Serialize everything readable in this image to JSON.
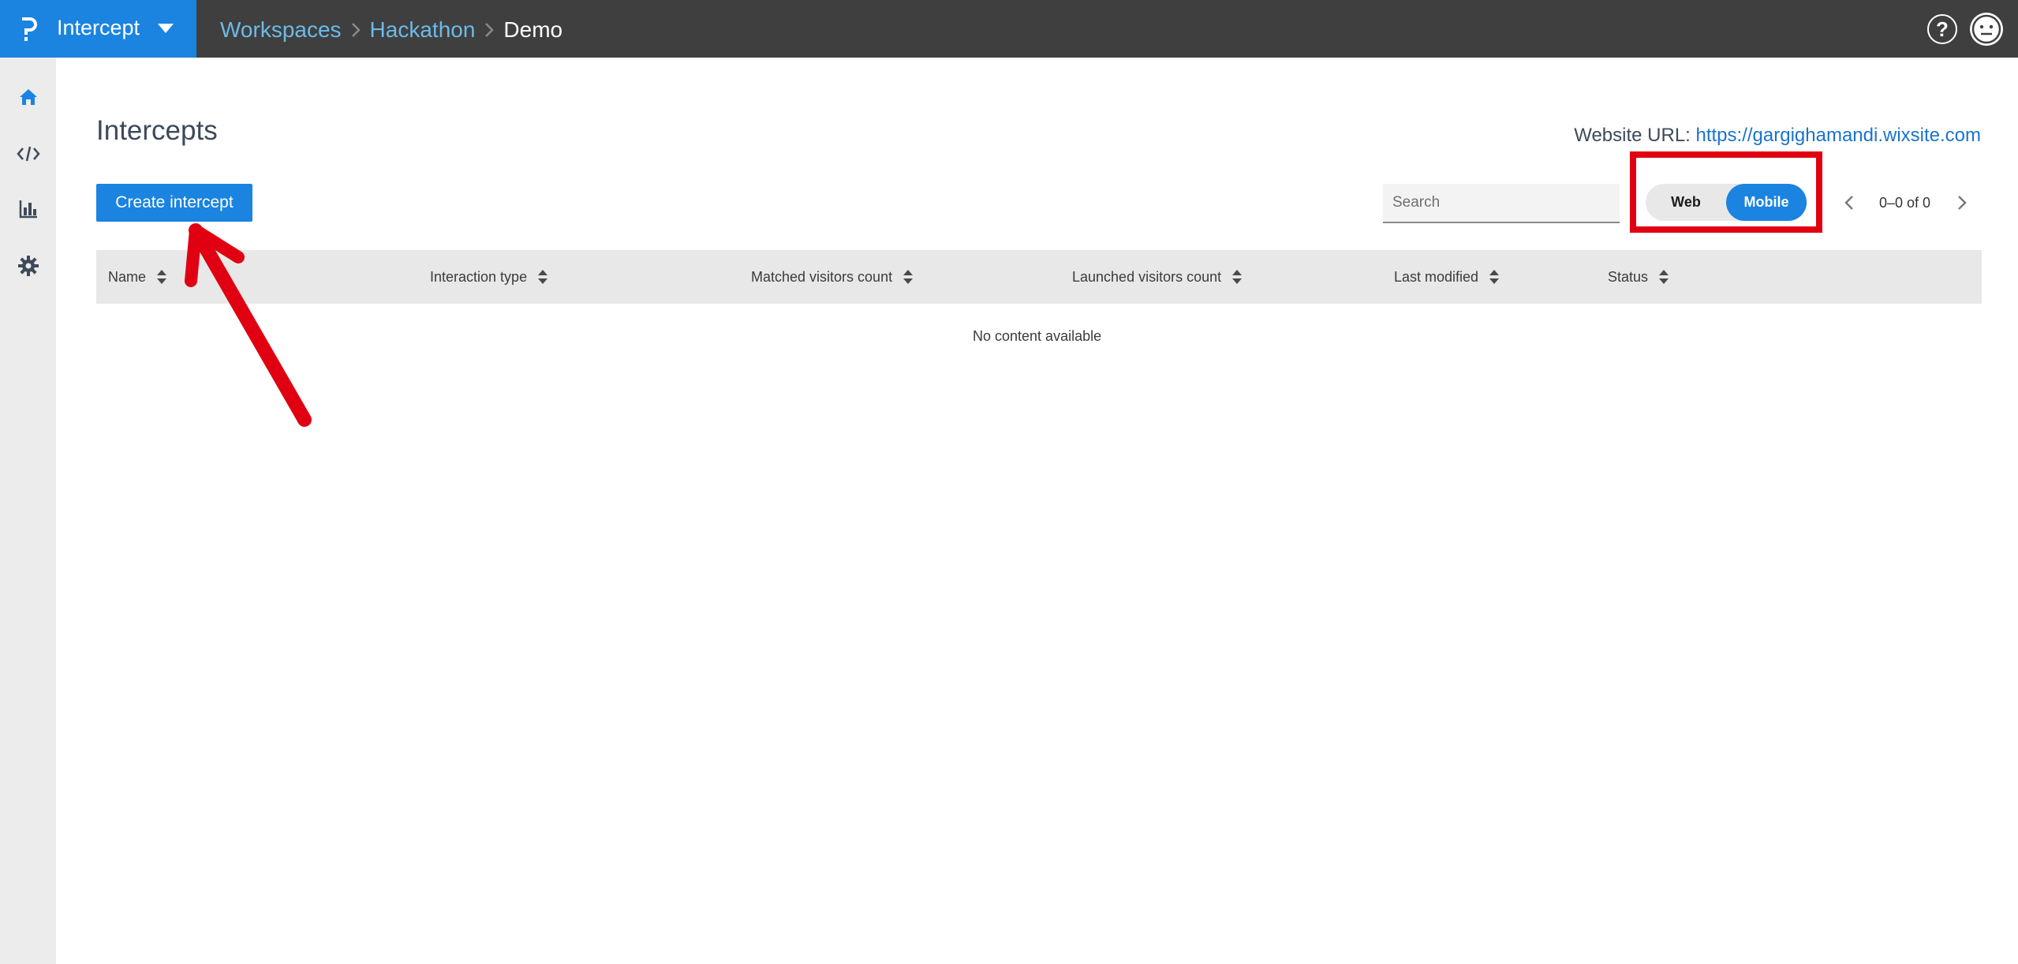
{
  "topbar": {
    "app_name": "Intercept",
    "breadcrumb": [
      {
        "label": "Workspaces"
      },
      {
        "label": "Hackathon"
      },
      {
        "label": "Demo"
      }
    ],
    "help_label": "?"
  },
  "main": {
    "title": "Intercepts",
    "website_url_label": "Website URL:",
    "website_url": "https://gargighamandi.wixsite.com",
    "create_button": "Create intercept",
    "search_placeholder": "Search",
    "toggle": {
      "options": [
        "Web",
        "Mobile"
      ],
      "selected": "Mobile"
    },
    "pager_text": "0–0 of 0",
    "table": {
      "columns": [
        "Name",
        "Interaction type",
        "Matched visitors count",
        "Launched visitors count",
        "Last modified",
        "Status"
      ],
      "rows": [],
      "empty_text": "No content available"
    }
  },
  "colors": {
    "accent": "#1a84e0",
    "topbar": "#3f3f3f",
    "sidebar": "#ececec",
    "annotation": "#e00011"
  }
}
